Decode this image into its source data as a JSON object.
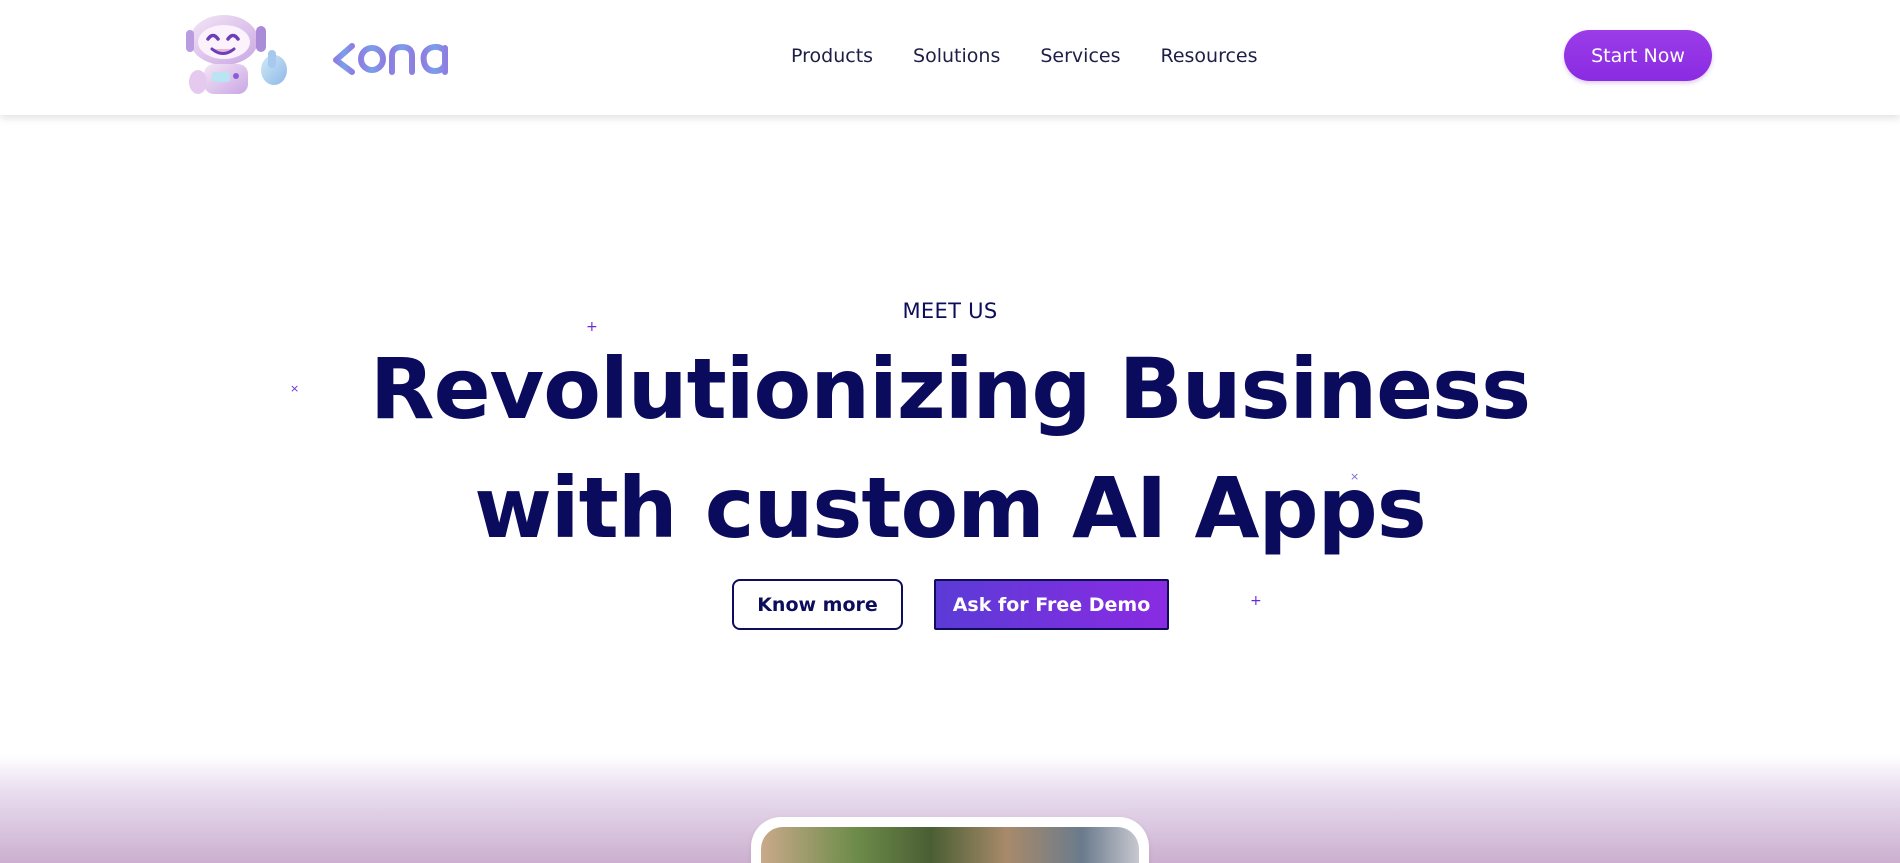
{
  "header": {
    "nav": [
      "Products",
      "Solutions",
      "Services",
      "Resources"
    ],
    "cta_label": "Start Now",
    "logo_text": "kona"
  },
  "hero": {
    "eyebrow": "MEET US",
    "title_line1": "Revolutionizing Business",
    "title_line2": "with custom AI Apps",
    "know_more_label": "Know more",
    "demo_label": "Ask for Free Demo"
  },
  "colors": {
    "primary_purple": "#8a2be2",
    "navy": "#0b0b5e",
    "logo_blue": "#7b8ce0"
  },
  "icons": {
    "mascot": "robot-mascot-icon",
    "sparkle": "sparkle-icon"
  }
}
